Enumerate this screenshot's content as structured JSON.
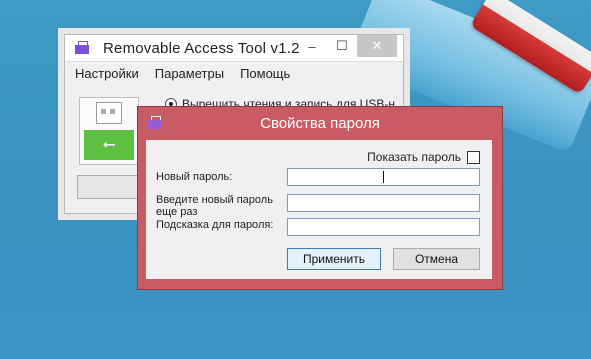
{
  "main_window": {
    "title": "Removable Access Tool v1.2",
    "controls": {
      "minimize": "–",
      "maximize": "☐",
      "close": "✕"
    },
    "menu": [
      "Настройки",
      "Параметры",
      "Помощь"
    ],
    "radio_label": "Вырешить чтения и запись для USB-н",
    "usb_symbol": "⭠"
  },
  "dialog": {
    "title": "Свойства пароля",
    "show_password_label": "Показать пароль",
    "new_password_label": "Новый пароль:",
    "repeat_password_label": "Введите новый пароль еще раз",
    "hint_label": "Подсказка для пароля:",
    "apply_label": "Применить",
    "cancel_label": "Отмена",
    "new_password_value": "",
    "repeat_password_value": "",
    "hint_value": ""
  },
  "colors": {
    "dialog_frame": "#c85b63",
    "desktop": "#3f9ac5",
    "usb_icon": "#7b4fd6",
    "usb_green": "#5ec040"
  }
}
